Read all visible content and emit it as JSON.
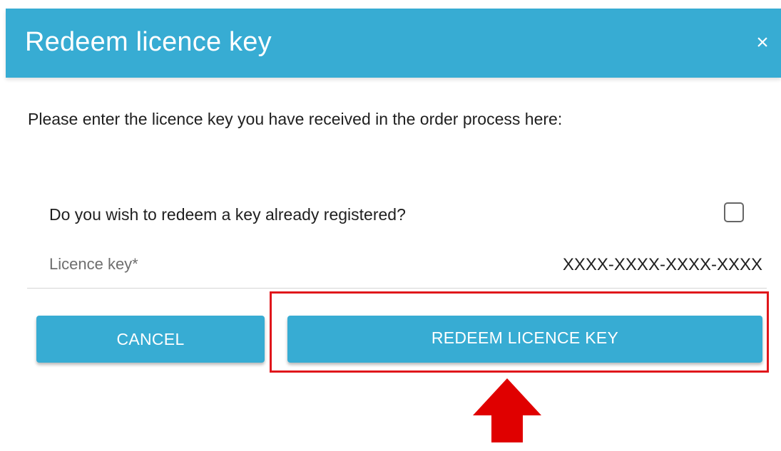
{
  "dialog": {
    "title": "Redeem licence key",
    "close_label": "×",
    "intro_text": "Please enter the licence key you have received in the order process here:",
    "registered_question": "Do you wish to redeem a key already registered?",
    "registered_checked": false,
    "licence_key_label": "Licence key*",
    "licence_key_value": "",
    "licence_key_placeholder": "XXXX-XXXX-XXXX-XXXX",
    "cancel_label": "CANCEL",
    "redeem_label": "REDEEM LICENCE KEY"
  },
  "annotation": {
    "highlight_color": "#e0161b",
    "arrow_color": "#e00000",
    "target": "redeem-button"
  },
  "colors": {
    "accent": "#37acd3",
    "text": "#1f1f1f",
    "muted_text": "#6e6e6e"
  },
  "icons": {
    "close": "close-icon",
    "arrow": "up-arrow-icon"
  }
}
